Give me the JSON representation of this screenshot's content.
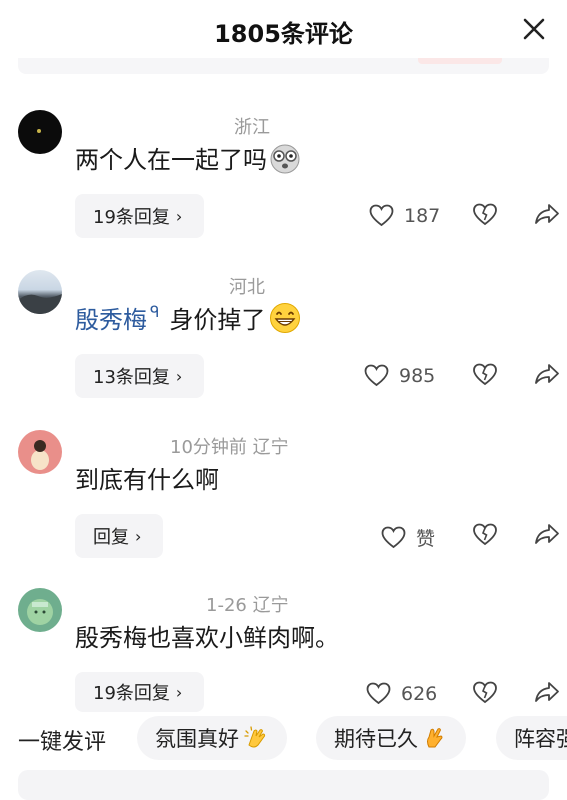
{
  "header": {
    "title": "1805条评论"
  },
  "comments": [
    {
      "meta": "浙江",
      "text": "两个人在一起了吗",
      "mention": "",
      "reply": "19条回复",
      "likes": "187"
    },
    {
      "meta": "河北",
      "text": "身价掉了",
      "mention": "殷秀梅",
      "reply": "13条回复",
      "likes": "985"
    },
    {
      "meta": "10分钟前  辽宁",
      "text": "到底有什么啊",
      "mention": "",
      "reply": "回复",
      "likes": "赞"
    },
    {
      "meta": "1-26  辽宁",
      "text": "殷秀梅也喜欢小鲜肉啊。",
      "mention": "",
      "reply": "19条回复",
      "likes": "626"
    }
  ],
  "quick": {
    "label": "一键发评",
    "chips": [
      "氛围真好",
      "期待已久",
      "阵容强"
    ]
  },
  "icons": {
    "close": "close-icon",
    "like": "heart-icon",
    "dislike": "broken-heart-icon",
    "share": "share-arrow-icon",
    "chevron": "chevron-right-icon"
  }
}
